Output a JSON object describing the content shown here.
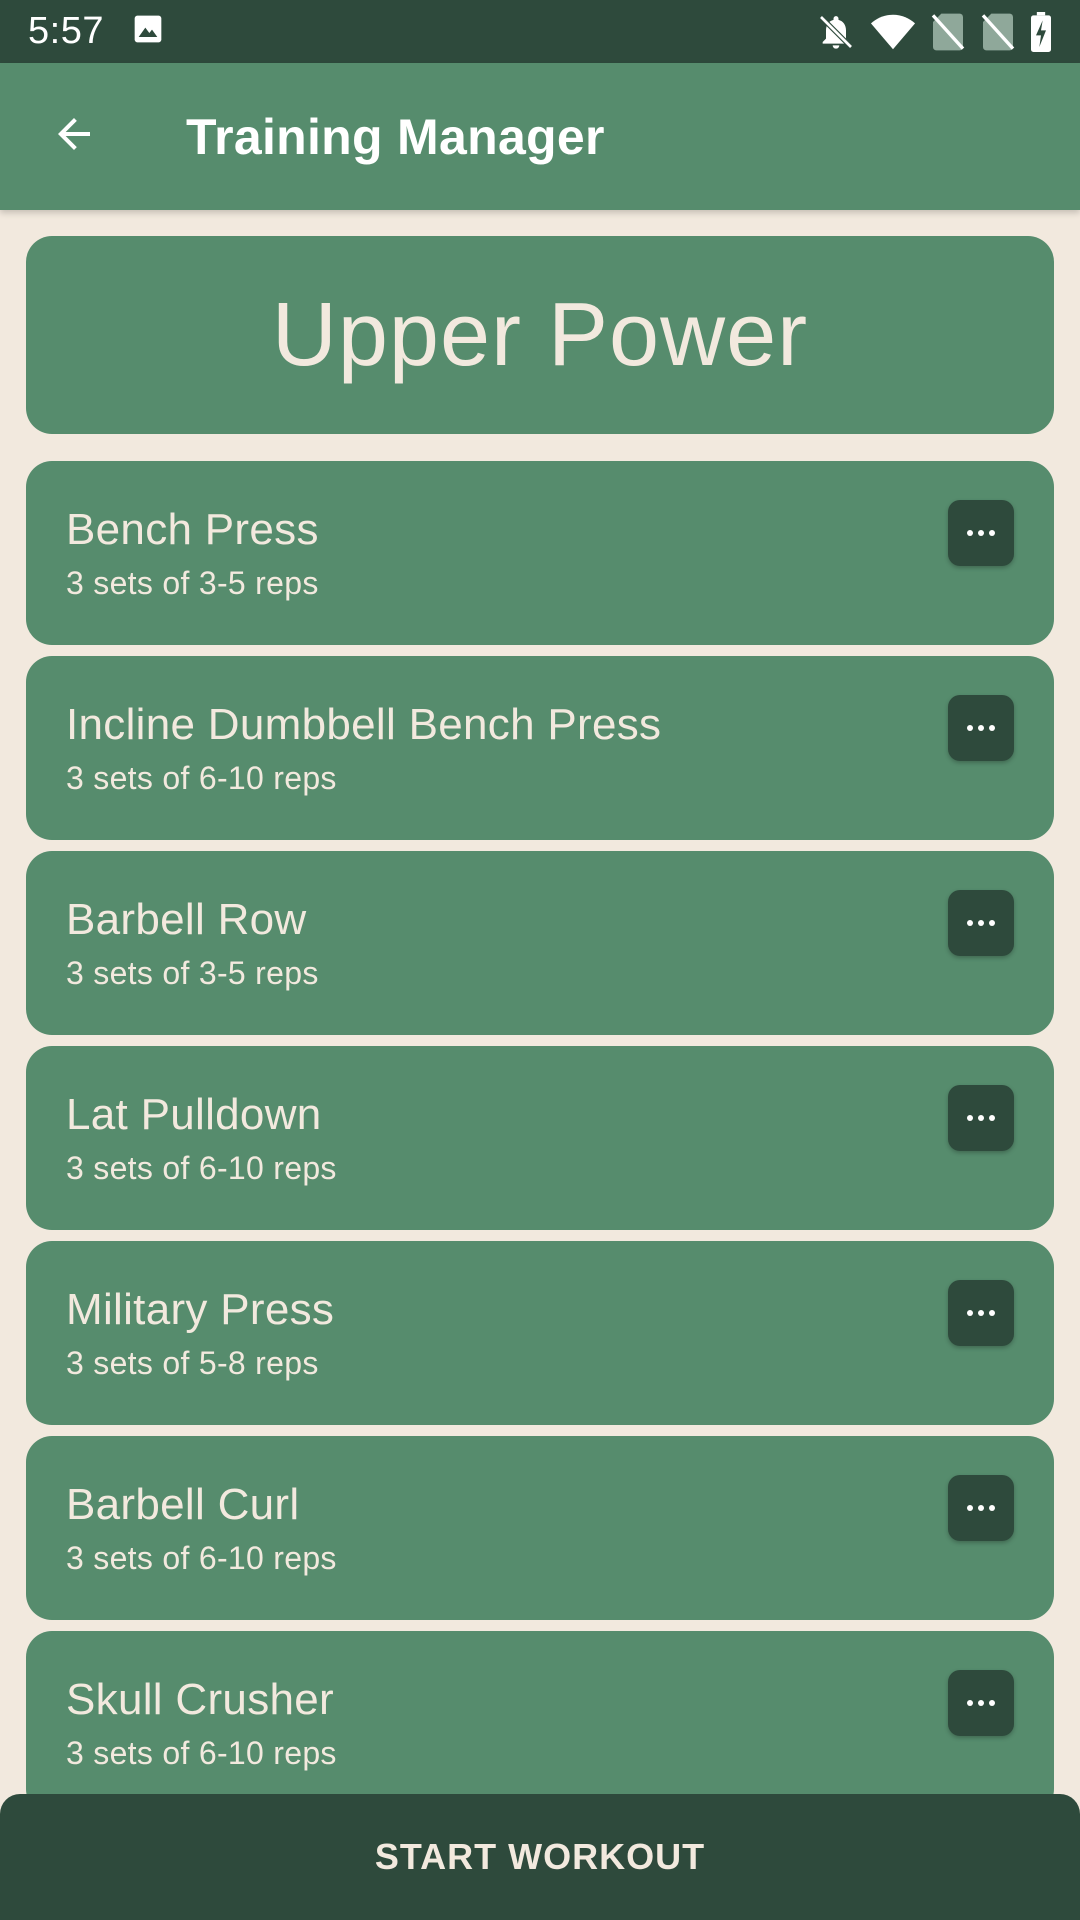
{
  "status_bar": {
    "time": "5:57",
    "left_icons": [
      "image-icon"
    ],
    "right_icons": [
      "bell-off-icon",
      "wifi-icon",
      "no-sim-icon",
      "no-sim-icon",
      "battery-charging-icon"
    ]
  },
  "app_bar": {
    "title": "Training Manager",
    "back_icon": "arrow-back-icon"
  },
  "workout": {
    "title": "Upper Power",
    "exercises": [
      {
        "name": "Bench Press",
        "scheme": "3 sets of 3-5 reps"
      },
      {
        "name": "Incline Dumbbell Bench Press",
        "scheme": "3 sets of 6-10 reps"
      },
      {
        "name": "Barbell Row",
        "scheme": "3 sets of 3-5 reps"
      },
      {
        "name": "Lat Pulldown",
        "scheme": "3 sets of 6-10 reps"
      },
      {
        "name": "Military Press",
        "scheme": "3 sets of 5-8 reps"
      },
      {
        "name": "Barbell Curl",
        "scheme": "3 sets of 6-10 reps"
      },
      {
        "name": "Skull Crusher",
        "scheme": "3 sets of 6-10 reps"
      }
    ]
  },
  "start_button": {
    "label": "START WORKOUT"
  },
  "colors": {
    "status_bar": "#2E4A3C",
    "primary": "#568C6D",
    "dark": "#2E4A3C",
    "background": "#F2E9DE",
    "text_light": "#F2E9DE"
  }
}
